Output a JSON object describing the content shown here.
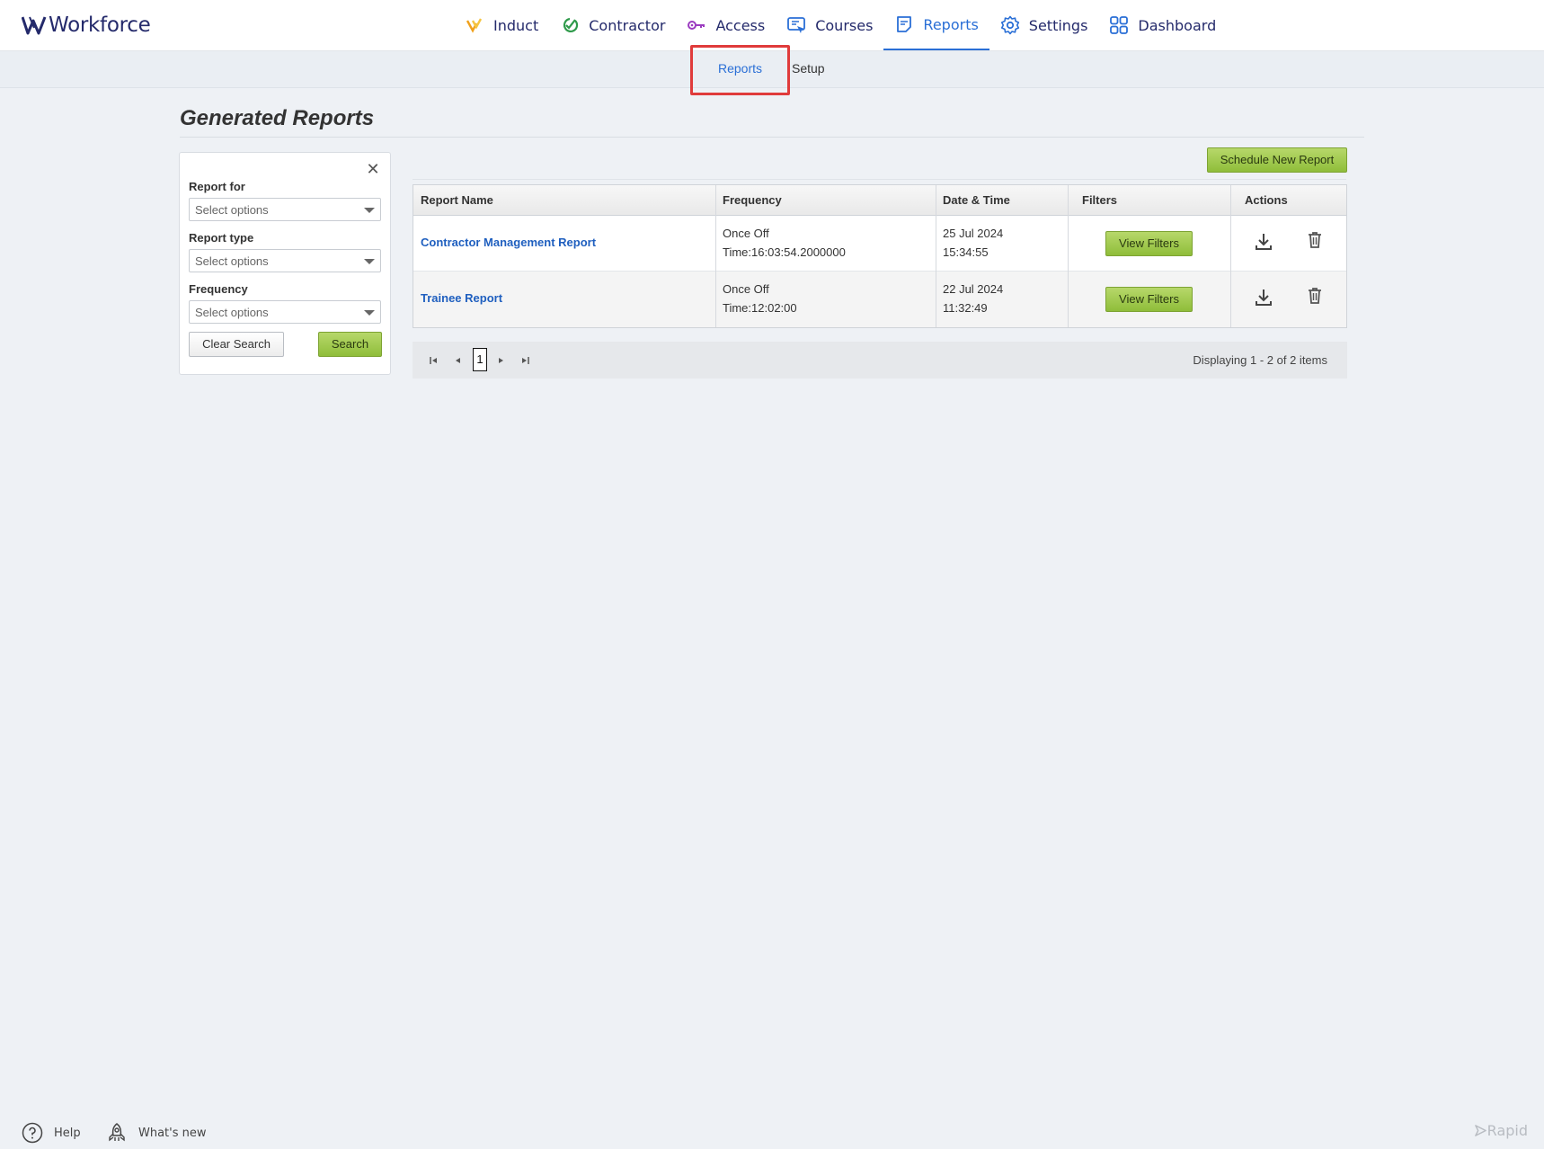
{
  "app": {
    "logo_text": "Workforce"
  },
  "nav": [
    {
      "label": "Induct",
      "icon": "induct-icon"
    },
    {
      "label": "Contractor",
      "icon": "contractor-icon"
    },
    {
      "label": "Access",
      "icon": "key-icon"
    },
    {
      "label": "Courses",
      "icon": "courses-icon"
    },
    {
      "label": "Reports",
      "icon": "reports-icon",
      "active": true
    },
    {
      "label": "Settings",
      "icon": "gear-icon"
    },
    {
      "label": "Dashboard",
      "icon": "grid-icon"
    }
  ],
  "subnav": {
    "reports": "Reports",
    "setup": "Setup"
  },
  "page": {
    "title": "Generated Reports"
  },
  "filters": {
    "report_for": {
      "label": "Report for",
      "placeholder": "Select options"
    },
    "report_type": {
      "label": "Report type",
      "placeholder": "Select options"
    },
    "frequency": {
      "label": "Frequency",
      "placeholder": "Select options"
    },
    "clear_label": "Clear Search",
    "search_label": "Search"
  },
  "toolbar": {
    "schedule_label": "Schedule New Report"
  },
  "table": {
    "columns": [
      "Report Name",
      "Frequency",
      "Date & Time",
      "Filters",
      "Actions"
    ],
    "rows": [
      {
        "name": "Contractor Management Report",
        "frequency": "Once Off",
        "time": "Time:16:03:54.2000000",
        "date": "25 Jul 2024",
        "clock": "15:34:55",
        "filters_label": "View Filters"
      },
      {
        "name": "Trainee Report",
        "frequency": "Once Off",
        "time": "Time:12:02:00",
        "date": "22 Jul 2024",
        "clock": "11:32:49",
        "filters_label": "View Filters"
      }
    ]
  },
  "pager": {
    "current_page": "1",
    "info": "Displaying 1 - 2 of 2 items"
  },
  "footer": {
    "help": "Help",
    "whats_new": "What's new",
    "brand": "Rapid"
  },
  "colors": {
    "accent": "#2a6fd6",
    "button_green": "#9fc94a",
    "highlight": "#e03b3b",
    "nav_text": "#242a6b"
  }
}
